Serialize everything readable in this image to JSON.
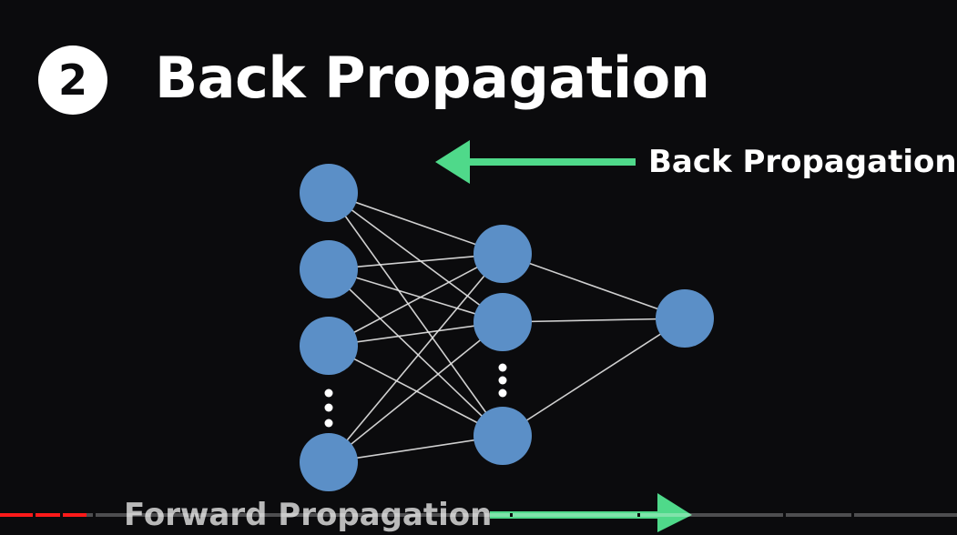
{
  "slide": {
    "step_number": "2",
    "title": "Back Propagation",
    "back_label": "Back Propagation",
    "forward_label": "Forward Propagation"
  },
  "diagram": {
    "layers": [
      {
        "name": "input",
        "visible_nodes": 4,
        "ellipsis": true
      },
      {
        "name": "hidden",
        "visible_nodes": 3,
        "ellipsis": true
      },
      {
        "name": "output",
        "visible_nodes": 1,
        "ellipsis": false
      }
    ],
    "fully_connected": true
  },
  "colors": {
    "background": "#0b0b0d",
    "node": "#5b8fc7",
    "edge": "#e6e6e6",
    "arrow": "#4fd98a",
    "text": "#ffffff"
  },
  "player": {
    "progress": 0.09
  }
}
